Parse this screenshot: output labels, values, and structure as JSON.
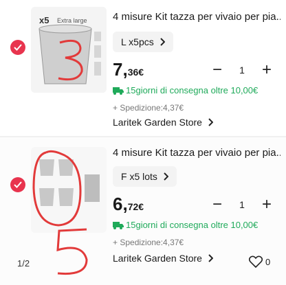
{
  "items": [
    {
      "title": "4 misure Kit tazza per vivaio per pia...",
      "thumb_badge": "x5",
      "thumb_caption": "Extra large",
      "variant": "L x5pcs",
      "price_int": "7,",
      "price_dec": "36€",
      "quantity": "1",
      "shipping": "15giorni di consegna oltre 10,00€",
      "fee": "+ Spedizione:4,37€",
      "store": "Laritek Garden Store",
      "annotation": "3",
      "selected": true
    },
    {
      "title": "4 misure Kit tazza per vivaio per pia...",
      "variant": "F x5 lots",
      "price_int": "6,",
      "price_dec": "72€",
      "quantity": "1",
      "shipping": "15giorni di consegna oltre 10,00€",
      "fee": "+ Spedizione:4,37€",
      "store": "Laritek Garden Store",
      "annotation": "5",
      "selected": true
    }
  ],
  "pager": "1/2",
  "wishlist_count": "0",
  "colors": {
    "accent": "#e8344e",
    "shipping": "#1faa5a",
    "annotation": "#e23a3a"
  }
}
